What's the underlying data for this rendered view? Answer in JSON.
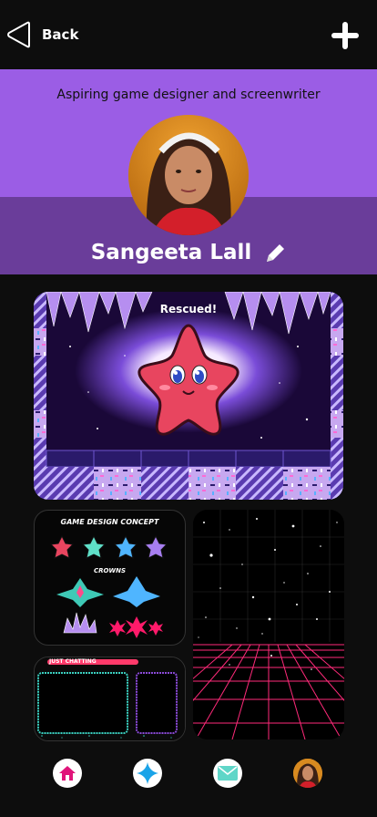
{
  "topbar": {
    "back_label": "Back"
  },
  "profile": {
    "bio": "Aspiring game designer and screenwriter",
    "name": "Sangeeta Lall"
  },
  "cards": {
    "main_caption": "Rescued!",
    "concept_title": "GAME DESIGN CONCEPT",
    "concept_subtitle": "CROWNS",
    "chat_label": "JUST CHATTING"
  },
  "icons": {
    "back": "back-triangle-icon",
    "add": "plus-icon",
    "edit": "pencil-icon",
    "home": "home-icon",
    "explore": "sparkle-icon",
    "mail": "mail-icon",
    "profile": "avatar"
  },
  "colors": {
    "header_light": "#9b5de5",
    "header_dark": "#6a3d9a",
    "home_icon": "#e0147a",
    "explore_icon": "#1aa3e8",
    "mail_icon": "#5fd6c8"
  }
}
